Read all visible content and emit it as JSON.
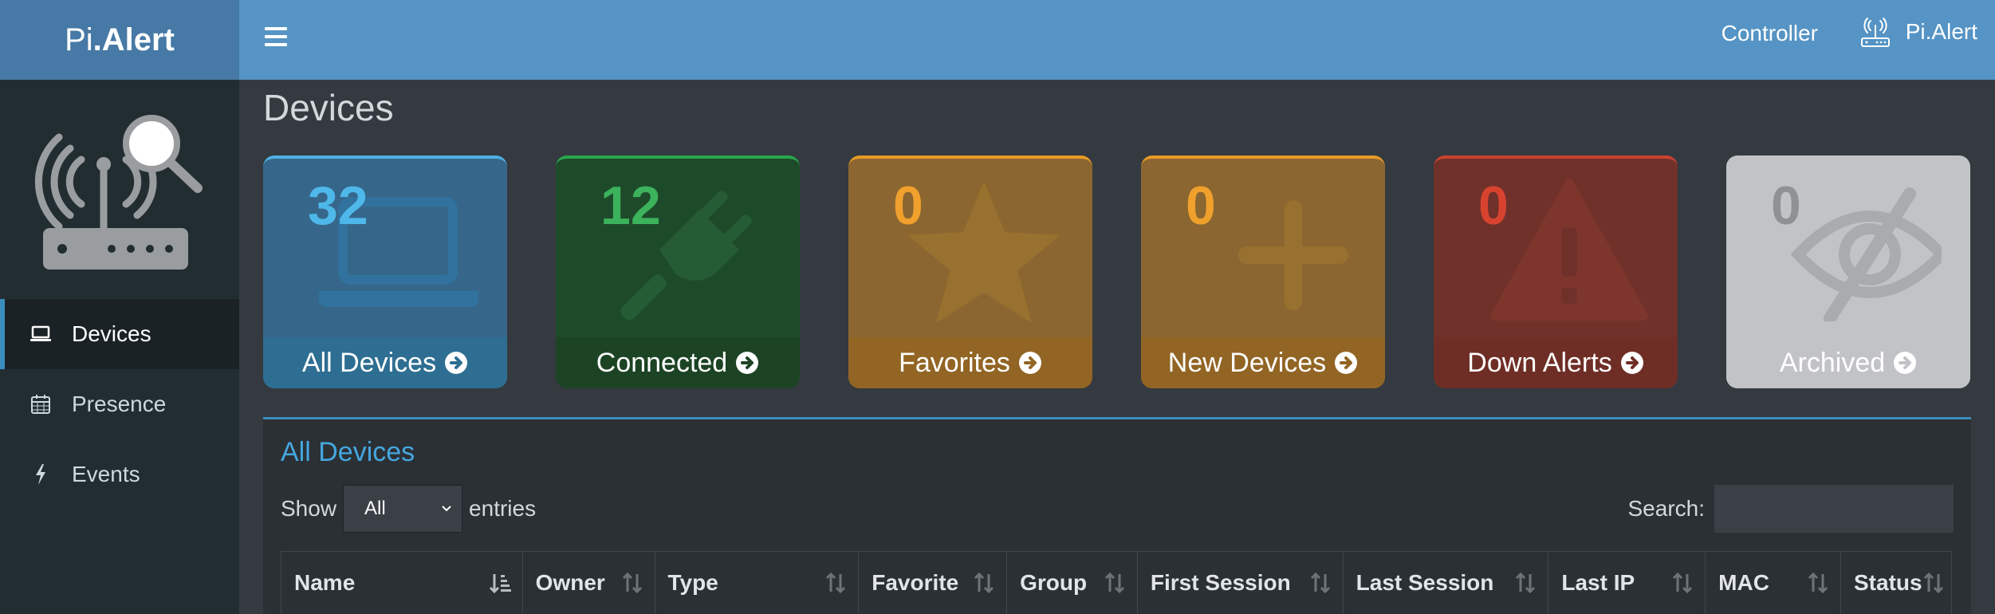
{
  "brand": {
    "light": "Pi",
    "bold": ".Alert"
  },
  "sidebar": {
    "items": [
      {
        "label": "Devices",
        "icon": "laptop-icon",
        "active": true
      },
      {
        "label": "Presence",
        "icon": "calendar-icon",
        "active": false
      },
      {
        "label": "Events",
        "icon": "bolt-icon",
        "active": false
      }
    ]
  },
  "header": {
    "controller_label": "Controller",
    "user_label": "Pi.Alert"
  },
  "page_title": "Devices",
  "cards": [
    {
      "count": "32",
      "label": "All Devices",
      "icon": "laptop-icon",
      "color": "#4fb8ea"
    },
    {
      "count": "12",
      "label": "Connected",
      "icon": "plug-icon",
      "color": "#3db25c"
    },
    {
      "count": "0",
      "label": "Favorites",
      "icon": "star-icon",
      "color": "#f0a02c"
    },
    {
      "count": "0",
      "label": "New Devices",
      "icon": "plus-icon",
      "color": "#f0a02c"
    },
    {
      "count": "0",
      "label": "Down Alerts",
      "icon": "warning-icon",
      "color": "#d8432f"
    },
    {
      "count": "0",
      "label": "Archived",
      "icon": "eye-slash-icon",
      "color": "#8f9295"
    }
  ],
  "table": {
    "title": "All Devices",
    "show_label": "Show",
    "entries_value": "All",
    "entries_label": "entries",
    "search_label": "Search:",
    "search_value": "",
    "columns": [
      "Name",
      "Owner",
      "Type",
      "Favorite",
      "Group",
      "First Session",
      "Last Session",
      "Last IP",
      "MAC",
      "Status"
    ]
  }
}
